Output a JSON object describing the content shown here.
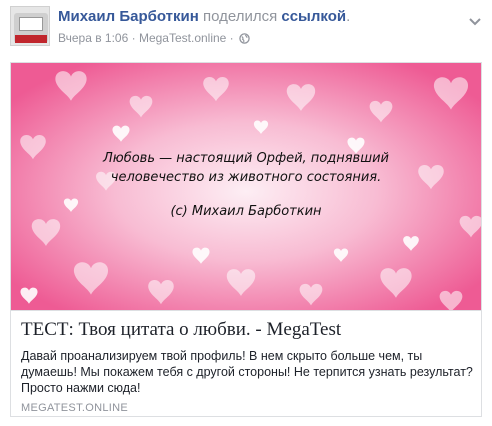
{
  "post": {
    "author_name": "Михаил Барботкин",
    "action_text": " поделился ",
    "object_text": "ссылкой",
    "trailing": ".",
    "timestamp": "Вчера в 1:06",
    "separator": " · ",
    "source": "MegaTest.online",
    "separator2": " · ",
    "privacy_icon": "globe-icon",
    "menu_icon": "chevron-down-icon"
  },
  "link_card": {
    "image_quote_line1": "Любовь — настоящий Орфей, поднявший",
    "image_quote_line2": "человечество из животного состояния.",
    "image_quote_author": "(c) Михаил Барботкин",
    "title": "ТЕСТ: Твоя цитата о любви. - MegaTest",
    "description": "Давай проанализируем твой профиль! В нем скрыто больше чем, ты думаешь! Мы покажем тебя с другой стороны! Не терпится узнать результат? Просто нажми сюда!",
    "domain": "MEGATEST.ONLINE"
  },
  "colors": {
    "author": "#365899",
    "meta": "#90949c",
    "image_bg_center": "#fde7f0",
    "image_bg_edge": "#f06a9e"
  }
}
